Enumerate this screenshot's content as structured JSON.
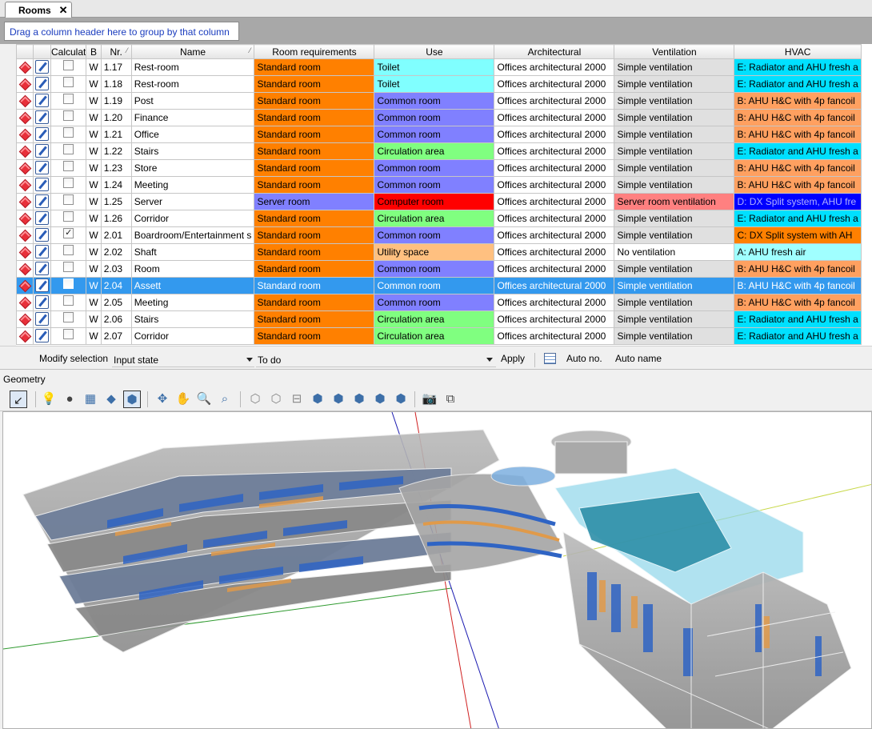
{
  "tab": {
    "label": "Rooms",
    "close": "✕"
  },
  "group_hint": "Drag a column header here to group by that column",
  "columns": [
    {
      "key": "status",
      "label": ""
    },
    {
      "key": "edit",
      "label": ""
    },
    {
      "key": "calc",
      "label": "Calculat"
    },
    {
      "key": "b",
      "label": "B"
    },
    {
      "key": "nr",
      "label": "Nr."
    },
    {
      "key": "name",
      "label": "Name"
    },
    {
      "key": "req",
      "label": "Room requirements"
    },
    {
      "key": "use",
      "label": "Use"
    },
    {
      "key": "arch",
      "label": "Architectural"
    },
    {
      "key": "vent",
      "label": "Ventilation"
    },
    {
      "key": "hvac",
      "label": "HVAC"
    }
  ],
  "rows": [
    {
      "checked": false,
      "b": "W",
      "nr": "1.17",
      "name": "Rest-room",
      "req": "Standard room",
      "use": "Toilet",
      "arch": "Offices architectural 2000",
      "vent": "Simple ventilation",
      "hvac": "E: Radiator and AHU fresh a"
    },
    {
      "checked": false,
      "b": "W",
      "nr": "1.18",
      "name": "Rest-room",
      "req": "Standard room",
      "use": "Toilet",
      "arch": "Offices architectural 2000",
      "vent": "Simple ventilation",
      "hvac": "E: Radiator and AHU fresh a"
    },
    {
      "checked": false,
      "b": "W",
      "nr": "1.19",
      "name": "Post",
      "req": "Standard room",
      "use": "Common room",
      "arch": "Offices architectural 2000",
      "vent": "Simple ventilation",
      "hvac": "B: AHU H&C with 4p fancoil"
    },
    {
      "checked": false,
      "b": "W",
      "nr": "1.20",
      "name": "Finance",
      "req": "Standard room",
      "use": "Common room",
      "arch": "Offices architectural 2000",
      "vent": "Simple ventilation",
      "hvac": "B: AHU H&C with 4p fancoil"
    },
    {
      "checked": false,
      "b": "W",
      "nr": "1.21",
      "name": "Office",
      "req": "Standard room",
      "use": "Common room",
      "arch": "Offices architectural 2000",
      "vent": "Simple ventilation",
      "hvac": "B: AHU H&C with 4p fancoil"
    },
    {
      "checked": false,
      "b": "W",
      "nr": "1.22",
      "name": "Stairs",
      "req": "Standard room",
      "use": "Circulation area",
      "arch": "Offices architectural 2000",
      "vent": "Simple ventilation",
      "hvac": "E: Radiator and AHU fresh a"
    },
    {
      "checked": false,
      "b": "W",
      "nr": "1.23",
      "name": "Store",
      "req": "Standard room",
      "use": "Common room",
      "arch": "Offices architectural 2000",
      "vent": "Simple ventilation",
      "hvac": "B: AHU H&C with 4p fancoil"
    },
    {
      "checked": false,
      "b": "W",
      "nr": "1.24",
      "name": "Meeting",
      "req": "Standard room",
      "use": "Common room",
      "arch": "Offices architectural 2000",
      "vent": "Simple ventilation",
      "hvac": "B: AHU H&C with 4p fancoil"
    },
    {
      "checked": false,
      "b": "W",
      "nr": "1.25",
      "name": "Server",
      "req": "Server room",
      "use": "Computer room",
      "arch": "Offices architectural 2000",
      "vent": "Server room ventilation",
      "hvac": "D: DX Split system, AHU fre"
    },
    {
      "checked": false,
      "b": "W",
      "nr": "1.26",
      "name": "Corridor",
      "req": "Standard room",
      "use": "Circulation area",
      "arch": "Offices architectural 2000",
      "vent": "Simple ventilation",
      "hvac": "E: Radiator and AHU fresh a"
    },
    {
      "checked": true,
      "b": "W",
      "nr": "2.01",
      "name": "Boardroom/Entertainment s",
      "req": "Standard room",
      "use": "Common room",
      "arch": "Offices architectural 2000",
      "vent": "Simple ventilation",
      "hvac": "C: DX Split system with AH"
    },
    {
      "checked": false,
      "b": "W",
      "nr": "2.02",
      "name": "Shaft",
      "req": "Standard room",
      "use": "Utility space",
      "arch": "Offices architectural 2000",
      "vent": "No ventilation",
      "hvac": "A: AHU fresh air"
    },
    {
      "checked": false,
      "b": "W",
      "nr": "2.03",
      "name": "Room",
      "req": "Standard room",
      "use": "Common room",
      "arch": "Offices architectural 2000",
      "vent": "Simple ventilation",
      "hvac": "B: AHU H&C with 4p fancoil"
    },
    {
      "checked": false,
      "b": "W",
      "nr": "2.04",
      "name": "Assett",
      "req": "Standard room",
      "use": "Common room",
      "arch": "Offices architectural 2000",
      "vent": "Simple ventilation",
      "hvac": "B: AHU H&C with 4p fancoil",
      "selected": true
    },
    {
      "checked": false,
      "b": "W",
      "nr": "2.05",
      "name": "Meeting",
      "req": "Standard room",
      "use": "Common room",
      "arch": "Offices architectural 2000",
      "vent": "Simple ventilation",
      "hvac": "B: AHU H&C with 4p fancoil"
    },
    {
      "checked": false,
      "b": "W",
      "nr": "2.06",
      "name": "Stairs",
      "req": "Standard room",
      "use": "Circulation area",
      "arch": "Offices architectural 2000",
      "vent": "Simple ventilation",
      "hvac": "E: Radiator and AHU fresh a"
    },
    {
      "checked": false,
      "b": "W",
      "nr": "2.07",
      "name": "Corridor",
      "req": "Standard room",
      "use": "Circulation area",
      "arch": "Offices architectural 2000",
      "vent": "Simple ventilation",
      "hvac": "E: Radiator and AHU fresh a"
    }
  ],
  "cell_colors": {
    "Standard room": "#ff8000",
    "Server room": "#8080ff",
    "Toilet": "#80ffff",
    "Common room": "#8080ff",
    "Circulation area": "#80ff80",
    "Computer room": "#ff0000",
    "Utility space": "#ffc080",
    "Offices architectural 2000": "#ffffff",
    "Simple ventilation": "#e0e0e0",
    "Server room ventilation": "#ff8080",
    "No ventilation": "#ffffff",
    "E: Radiator and AHU fresh a": "#00e0ff",
    "B: AHU H&C with 4p fancoil": "#ffa060",
    "D: DX Split system, AHU fre": "#0000ff",
    "C: DX Split system with AH": "#ff8000",
    "A: AHU fresh air": "#a0ffff"
  },
  "modify_bar": {
    "label": "Modify selection",
    "field_value": "Input state",
    "state_value": "To do",
    "apply": "Apply",
    "auto_no": "Auto no.",
    "auto_name": "Auto name"
  },
  "geometry": {
    "title": "Geometry"
  },
  "toolbar_icons": [
    "select-arrow-icon",
    "light-bulb-on-icon",
    "light-bulb-off-icon",
    "floor-blocks-icon",
    "floor-plate-icon",
    "cube-3d-icon",
    "rotate-icon",
    "pan-hand-icon",
    "zoom-icon",
    "zoom-extents-icon",
    "view-box-1-icon",
    "view-box-2-icon",
    "view-box-3-icon",
    "view-box-4-icon",
    "view-box-5-icon",
    "view-box-6-icon",
    "view-box-7-icon",
    "view-box-8-icon",
    "camera-icon",
    "export-image-icon"
  ]
}
